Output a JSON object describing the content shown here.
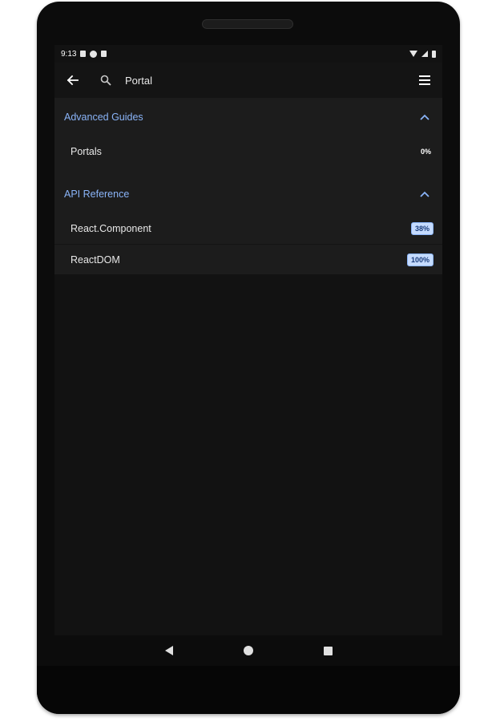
{
  "status_bar": {
    "time": "9:13",
    "left_icons": [
      "notification-icon",
      "app-icon",
      "sd-card-icon"
    ],
    "right_icons": [
      "wifi-icon",
      "signal-icon",
      "battery-icon"
    ]
  },
  "toolbar": {
    "back_icon": "arrow-back-icon",
    "search_icon": "search-icon",
    "search_query": "Portal",
    "menu_icon": "menu-icon"
  },
  "sections": [
    {
      "title": "Advanced Guides",
      "items": [
        {
          "label": "Portals",
          "progress": "0%",
          "highlighted": false
        }
      ]
    },
    {
      "title": "API Reference",
      "items": [
        {
          "label": "React.Component",
          "progress": "38%",
          "highlighted": true
        },
        {
          "label": "ReactDOM",
          "progress": "100%",
          "highlighted": true
        }
      ]
    }
  ],
  "nav_bar": {
    "buttons": [
      "back-triangle-icon",
      "home-circle-icon",
      "recents-square-icon"
    ]
  },
  "colors": {
    "accent": "#8ab4f8",
    "background": "#121212",
    "list_background": "#1c1c1c",
    "badge_background": "#c5dbff"
  }
}
